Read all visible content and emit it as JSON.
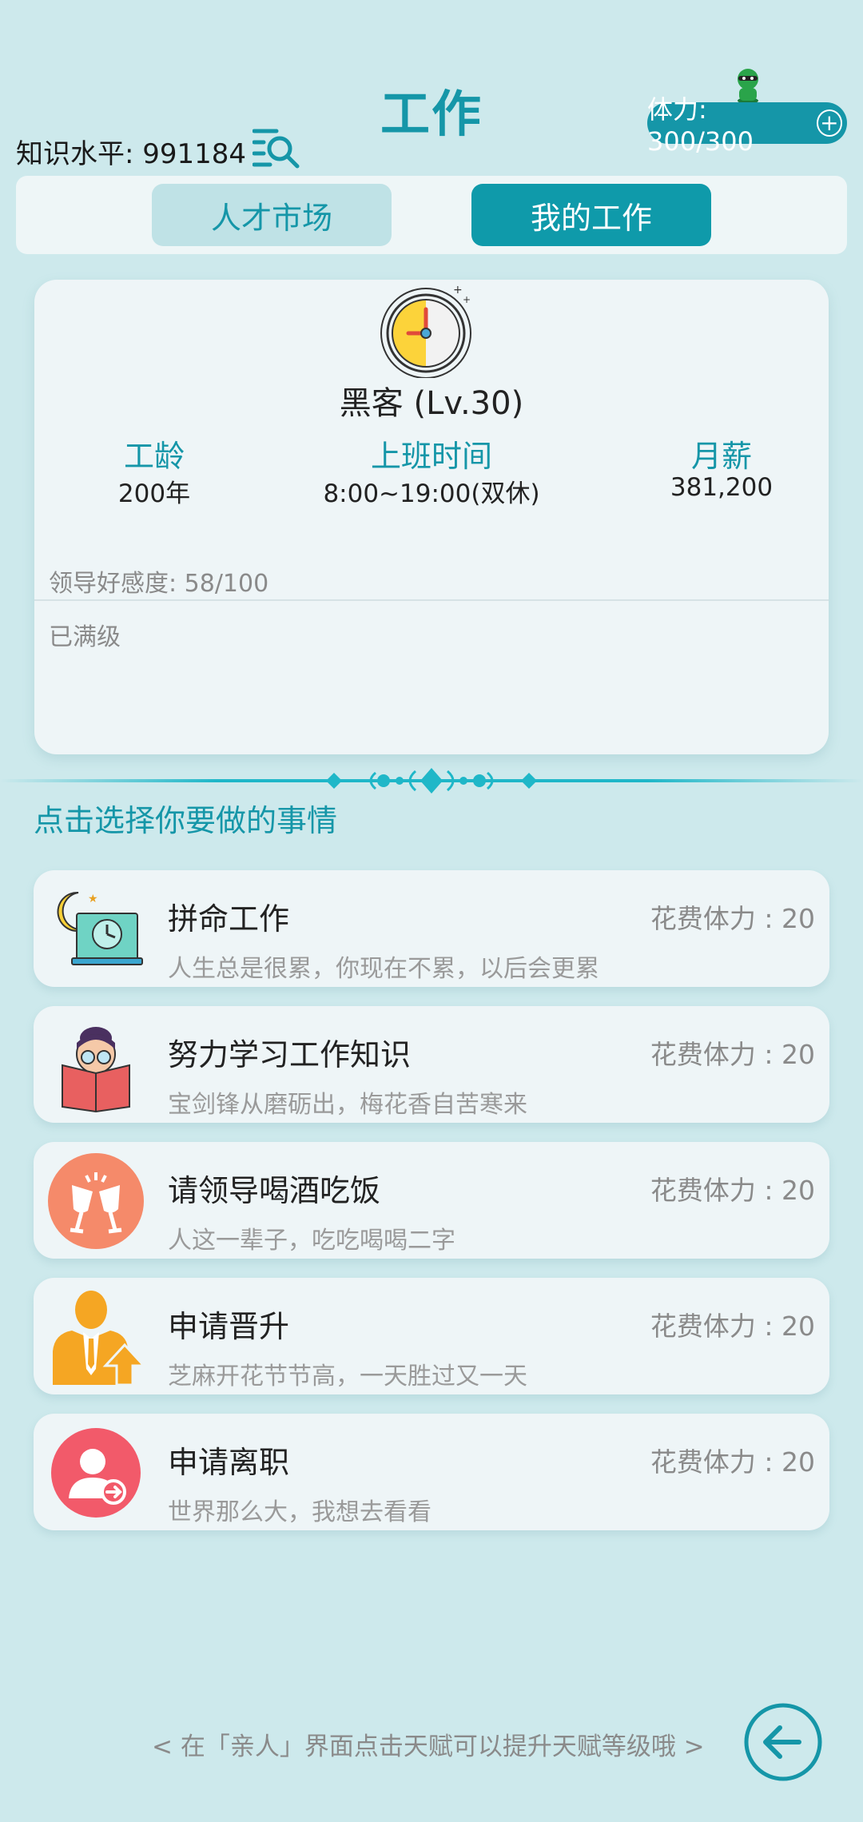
{
  "header": {
    "title": "工作",
    "stamina": "体力: 300/300",
    "stamina_plus_icon": "+",
    "knowledge": "知识水平: 991184"
  },
  "tabs": {
    "market": "人才市场",
    "mine": "我的工作"
  },
  "job": {
    "name": "黑客 (Lv.30)",
    "seniority_label": "工龄",
    "seniority_value": "200年",
    "hours_label": "上班时间",
    "hours_value": "8:00~19:00(双休)",
    "salary_label": "月薪",
    "salary_value": "381,200",
    "favor": "领导好感度: 58/100",
    "maxed": "已满级"
  },
  "section_title": "点击选择你要做的事情",
  "actions": [
    {
      "title": "拼命工作",
      "cost": "花费体力 : 20",
      "desc": "人生总是很累，你现在不累，以后会更累",
      "icon": "night-work-icon"
    },
    {
      "title": "努力学习工作知识",
      "cost": "花费体力 : 20",
      "desc": "宝剑锋从磨砺出，梅花香自苦寒来",
      "icon": "study-book-icon"
    },
    {
      "title": "请领导喝酒吃饭",
      "cost": "花费体力 : 20",
      "desc": "人这一辈子，吃吃喝喝二字",
      "icon": "toast-glasses-icon"
    },
    {
      "title": "申请晋升",
      "cost": "花费体力 : 20",
      "desc": "芝麻开花节节高，一天胜过又一天",
      "icon": "promotion-icon"
    },
    {
      "title": "申请离职",
      "cost": "花费体力 : 20",
      "desc": "世界那么大，我想去看看",
      "icon": "resign-icon"
    }
  ],
  "footer": {
    "hint": "< 在「亲人」界面点击天赋可以提升天赋等级哦 >"
  },
  "colors": {
    "background": "#cde9ec",
    "accent": "#1596a8",
    "card": "#eef5f7"
  }
}
